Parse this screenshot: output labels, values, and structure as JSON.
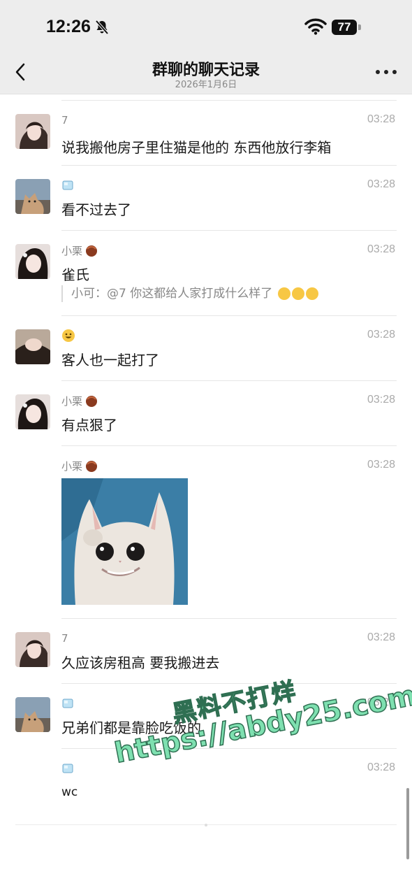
{
  "status_bar": {
    "time": "12:26",
    "battery": "77"
  },
  "header": {
    "title": "群聊的聊天记录",
    "subtitle": "2026年1月6日"
  },
  "messages": [
    {
      "sender": "7",
      "time": "03:28",
      "text": "说我搬他房子里住猫是他的 东西他放行李箱"
    },
    {
      "sender": "",
      "time": "03:28",
      "text": "看不过去了"
    },
    {
      "sender": "小栗",
      "time": "03:28",
      "text": "雀氏",
      "quote": "小可：@7 你这都给人家打成什么样了"
    },
    {
      "sender": "",
      "time": "03:28",
      "text": "客人也一起打了"
    },
    {
      "sender": "小栗",
      "time": "03:28",
      "text": "有点狠了"
    },
    {
      "sender": "小栗",
      "time": "03:28",
      "text": ""
    },
    {
      "sender": "7",
      "time": "03:28",
      "text": "久应该房租高 要我搬进去"
    },
    {
      "sender": "",
      "time": "03:28",
      "text": "兄弟们都是靠脸吃饭的"
    },
    {
      "sender": "",
      "time": "03:28",
      "text": "wc"
    }
  ],
  "watermark": {
    "line1": "黑料不打烊",
    "line2": "https://abdy25.com"
  },
  "icons": [
    "bell-muted-icon",
    "wifi-icon",
    "battery-icon",
    "back-chevron-icon",
    "more-dots-icon",
    "ice-cube-icon",
    "chestnut-icon",
    "smiley-icon",
    "laugh-cry-icon"
  ]
}
